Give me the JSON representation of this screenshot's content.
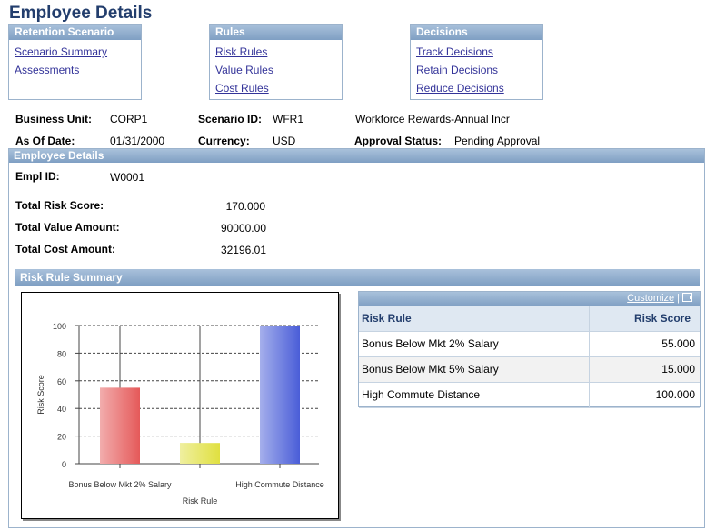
{
  "page_title": "Employee Details",
  "nav": {
    "retention": {
      "title": "Retention Scenario",
      "links": [
        "Scenario Summary",
        "Assessments"
      ]
    },
    "rules": {
      "title": "Rules",
      "links": [
        "Risk Rules",
        "Value Rules",
        "Cost Rules"
      ]
    },
    "decisions": {
      "title": "Decisions",
      "links": [
        "Track Decisions",
        "Retain Decisions",
        "Reduce Decisions"
      ]
    }
  },
  "header_fields": {
    "business_unit_label": "Business Unit:",
    "business_unit": "CORP1",
    "scenario_id_label": "Scenario ID:",
    "scenario_id": "WFR1",
    "scenario_desc": "Workforce Rewards-Annual Incr",
    "as_of_date_label": "As Of Date:",
    "as_of_date": "01/31/2000",
    "currency_label": "Currency:",
    "currency": "USD",
    "approval_status_label": "Approval Status:",
    "approval_status": "Pending Approval"
  },
  "employee": {
    "section_title": "Employee Details",
    "empl_id_label": "Empl ID:",
    "empl_id": "W0001",
    "total_risk_label": "Total Risk Score:",
    "total_risk": "170.000",
    "total_value_label": "Total Value Amount:",
    "total_value": "90000.00",
    "total_cost_label": "Total Cost Amount:",
    "total_cost": "32196.01"
  },
  "risk_summary": {
    "title": "Risk Rule Summary",
    "customize_label": "Customize",
    "separator": "|",
    "columns": [
      "Risk Rule",
      "Risk Score"
    ],
    "rows": [
      {
        "rule": "Bonus Below Mkt 2% Salary",
        "score": "55.000"
      },
      {
        "rule": "Bonus Below Mkt 5% Salary",
        "score": "15.000"
      },
      {
        "rule": "High Commute Distance",
        "score": "100.000"
      }
    ]
  },
  "chart_data": {
    "type": "bar",
    "categories": [
      "Bonus Below Mkt 2% Salary",
      "Bonus Below Mkt 5% Salary",
      "High Commute Distance"
    ],
    "tick_labels_shown": [
      "Bonus Below Mkt 2% Salary",
      "",
      "High Commute Distance"
    ],
    "values": [
      55,
      15,
      100
    ],
    "colors": [
      "#e55a5a",
      "#e0e040",
      "#4a5ed8"
    ],
    "xlabel": "Risk Rule",
    "ylabel": "Risk Score",
    "ylim": [
      0,
      100
    ],
    "yticks": [
      0,
      20,
      40,
      60,
      80,
      100
    ],
    "grid": "horizontal dashed"
  }
}
